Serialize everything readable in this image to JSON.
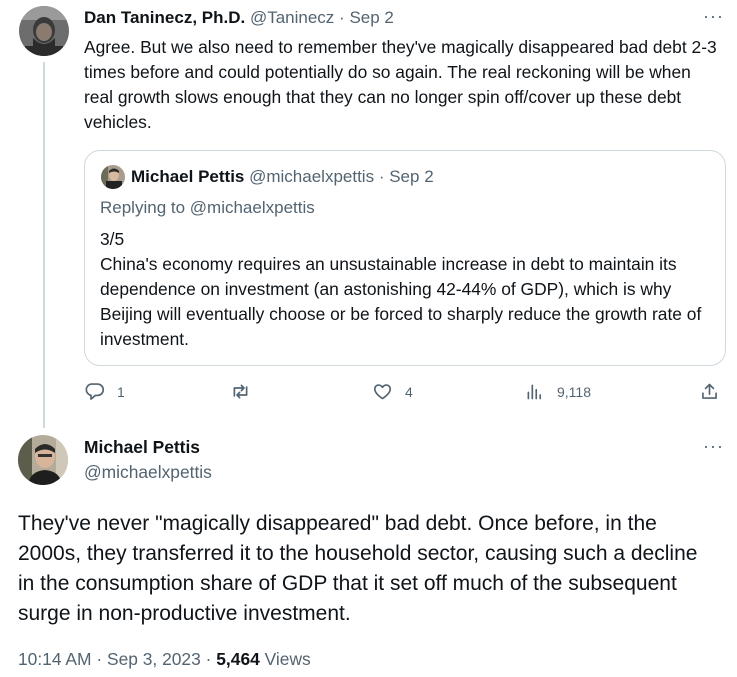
{
  "reply_tweet": {
    "author_name": "Dan Taninecz, Ph.D.",
    "author_handle": "@Taninecz",
    "separator": "·",
    "date": "Sep 2",
    "more": "···",
    "text": "Agree. But we also need to remember they've magically disappeared bad debt 2-3 times before and could potentially do so again. The real reckoning will be when real growth slows enough that they can no longer spin off/cover up these debt vehicles."
  },
  "quoted_tweet": {
    "author_name": "Michael Pettis",
    "author_handle": "@michaelxpettis",
    "separator": "·",
    "date": "Sep 2",
    "replying_to": "Replying to @michaelxpettis",
    "counter": "3/5",
    "text": "China's economy requires an unsustainable increase in debt to maintain its dependence on investment (an astonishing 42-44% of GDP), which is why Beijing will eventually choose or be forced to sharply reduce the growth rate of investment."
  },
  "actions": {
    "replies": "1",
    "retweets": "",
    "likes": "4",
    "views": "9,118",
    "icons": [
      "reply-icon",
      "retweet-icon",
      "like-icon",
      "views-icon",
      "share-icon"
    ]
  },
  "main_tweet": {
    "author_name": "Michael Pettis",
    "author_handle": "@michaelxpettis",
    "more": "···",
    "text": "They've never \"magically disappeared\" bad debt. Once before, in the 2000s, they transferred it to the household sector, causing such a decline in the consumption share of GDP that it set off much of the subsequent surge in non-productive investment.",
    "time": "10:14 AM",
    "separator": "·",
    "date": "Sep 3, 2023",
    "views_count": "5,464",
    "views_label": "Views"
  },
  "colors": {
    "primary_text": "#0f1419",
    "secondary_text": "#536471",
    "border": "#cfd9de"
  }
}
